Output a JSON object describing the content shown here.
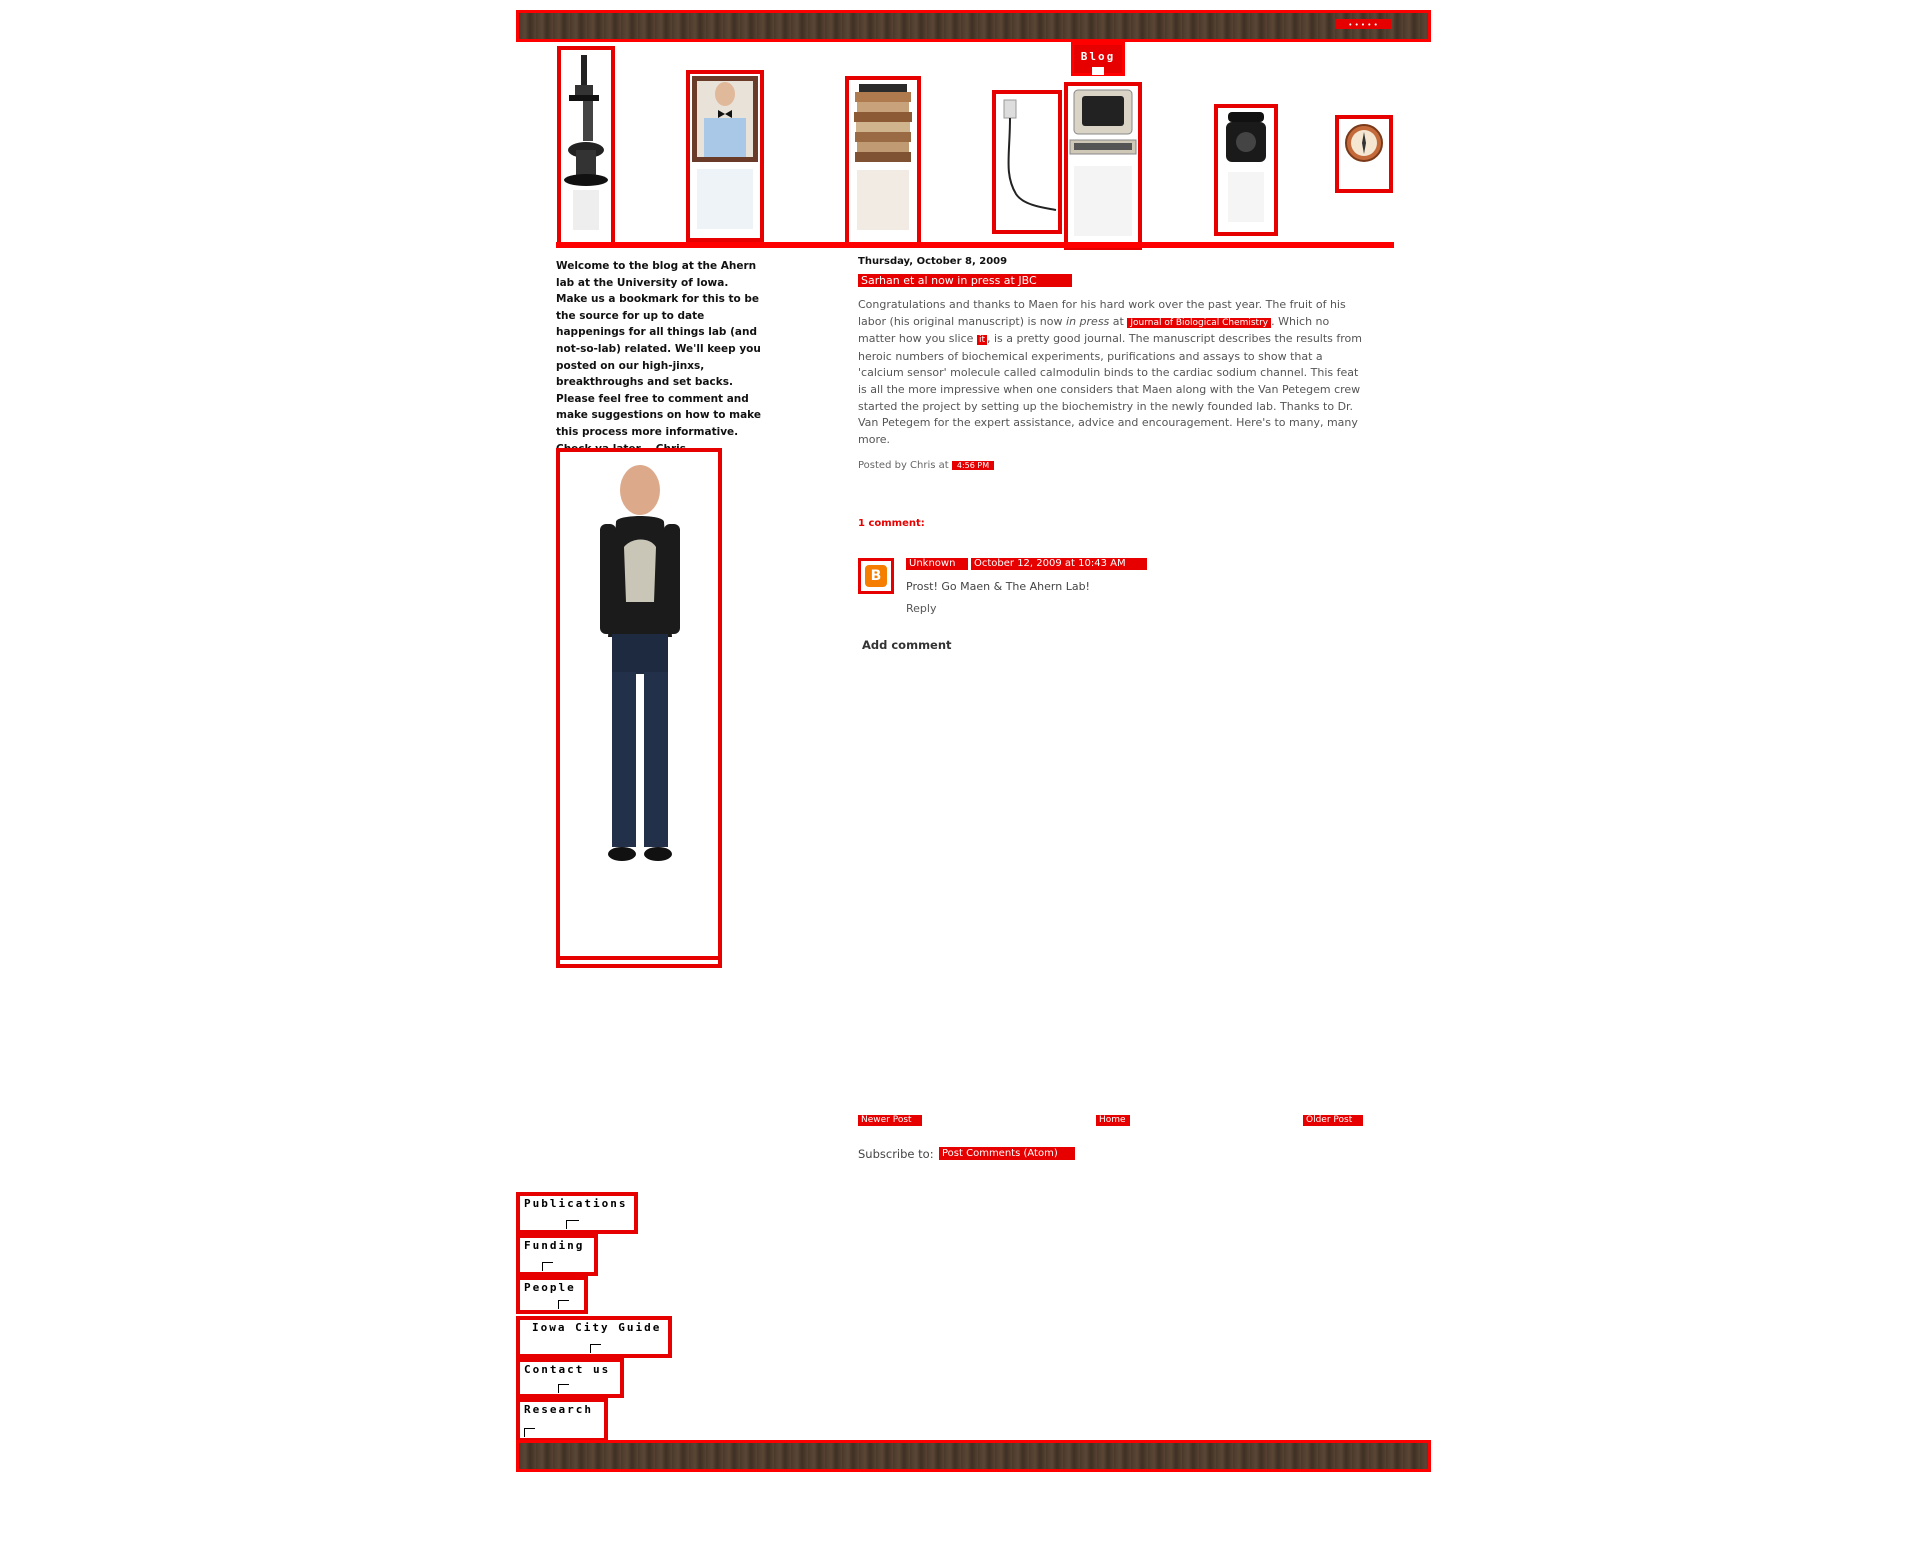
{
  "header": {
    "top_label": "• • • • •"
  },
  "nav_icons": [
    {
      "name": "microscope"
    },
    {
      "name": "person-bowtie"
    },
    {
      "name": "paper-stack"
    },
    {
      "name": "power-cord"
    },
    {
      "name": "computer",
      "tooltip": "Blog"
    },
    {
      "name": "telephone"
    },
    {
      "name": "compass"
    }
  ],
  "sidebar": {
    "intro": "Welcome to the blog at the Ahern lab at the University of Iowa. Make us a bookmark for this to be the source for up to date happenings for all things lab (and not-so-lab) related. We'll keep you posted on our high-jinxs, breakthroughs and set backs. Please feel free to comment and make suggestions on how to make this process more informative. Check ya later. – Chris"
  },
  "post": {
    "date": "Thursday, October 8, 2009",
    "title": "Sarhan et al now in press at JBC",
    "body_1": "Congratulations and thanks to Maen for his hard work over the past year. The fruit of his labor (his original manuscript) is now ",
    "body_italic": "in press",
    "body_2": " at ",
    "journal_link": "Journal of Biological Chemistry",
    "body_3": ". Which no matter how you slice ",
    "it_link": "it",
    "body_4": ", is a pretty good journal. The manuscript describes the results from heroic numbers of biochemical experiments, purifications and assays to show that a 'calcium sensor' molecule called calmodulin binds to the cardiac sodium channel. This feat is all the more impressive when one considers that Maen along with the Van Petegem crew started the project by setting up the biochemistry in the newly founded lab. Thanks to Dr. Van Petegem for the expert assistance, advice and encouragement. Here's to many, many more.",
    "posted_by": "Posted by Chris at",
    "time_link": "4:56 PM",
    "comments_heading": "1 comment:",
    "comment": {
      "author": "Unknown",
      "date": "October 12, 2009 at 10:43 AM",
      "text": "Prost! Go Maen & The Ahern Lab!",
      "reply": "Reply"
    },
    "add_comment": "Add comment"
  },
  "pager": {
    "newer": "Newer Post",
    "home": "Home",
    "older": "Older Post",
    "subscribe_label": "Subscribe to:",
    "subscribe_link": "Post Comments (Atom)"
  },
  "side_nav": [
    {
      "label": "Publications"
    },
    {
      "label": "Funding"
    },
    {
      "label": "People"
    },
    {
      "label": "Iowa City Guide"
    },
    {
      "label": "Contact us"
    },
    {
      "label": "Research"
    }
  ],
  "colors": {
    "accent": "#e60000",
    "wood": "#4a3a2c"
  }
}
